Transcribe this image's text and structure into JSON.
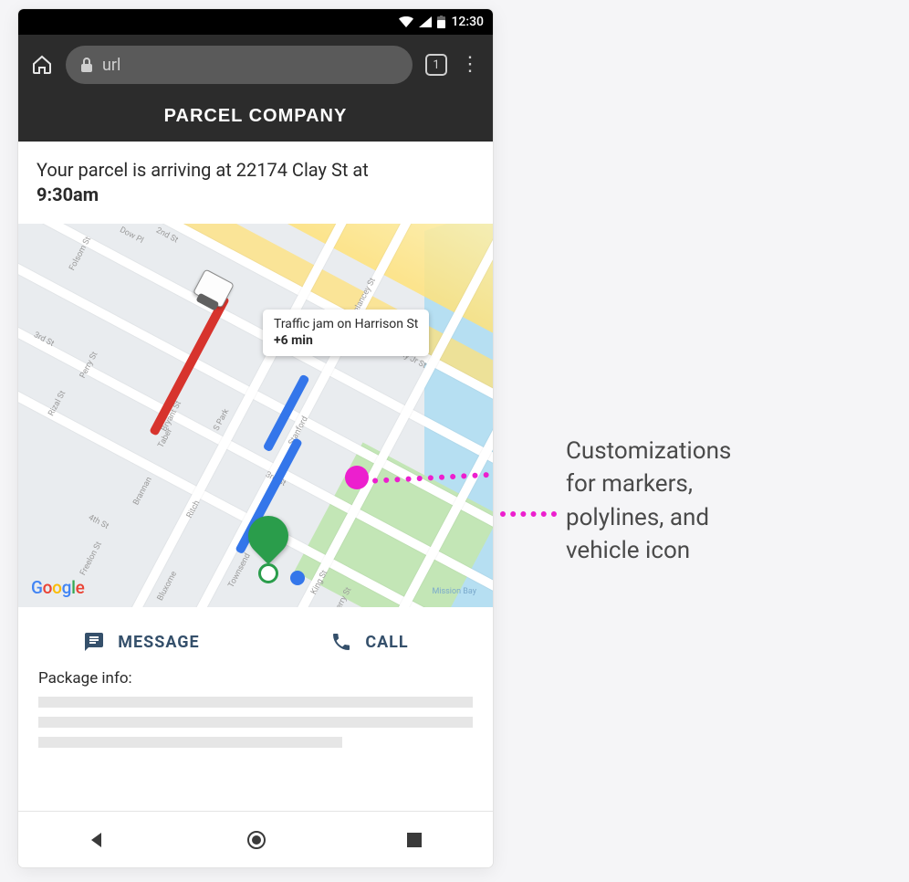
{
  "status_bar": {
    "time": "12:30"
  },
  "browser": {
    "url_text": "url",
    "tab_count": "1"
  },
  "brand": {
    "title": "PARCEL COMPANY"
  },
  "arrival": {
    "line1": "Your parcel is arriving at 22174 Clay St at",
    "time": "9:30am"
  },
  "map": {
    "card": {
      "line1": "Traffic jam on Harrison St",
      "delay": "+6 min"
    },
    "attribution": "Google",
    "streets": {
      "folsom": "Folsom St",
      "second": "2nd St",
      "third": "3rd St",
      "fourth": "4th St",
      "king": "King St",
      "brannan": "Brannan",
      "townsend": "Townsend",
      "bryant": "Bryant St",
      "harrison": "Harrison St",
      "perry": "Perry St",
      "dow": "Dow Pl",
      "ritch": "Ritch",
      "taber": "Taber",
      "spark": "S Park",
      "stanford": "Stanford",
      "berry": "Berry St",
      "rizal": "Rizal St",
      "freelon": "Freelon St",
      "bluxome": "Bluxome",
      "missionbay": "Mission Bay",
      "delancey": "Delancey St",
      "colinpkelly": "Colin P Kelly Jr St"
    }
  },
  "actions": {
    "message": "MESSAGE",
    "call": "CALL"
  },
  "package": {
    "label": "Package info:"
  },
  "annotation": {
    "line1": "Customizations",
    "line2": "for markers,",
    "line3": "polylines, and",
    "line4": "vehicle icon"
  }
}
